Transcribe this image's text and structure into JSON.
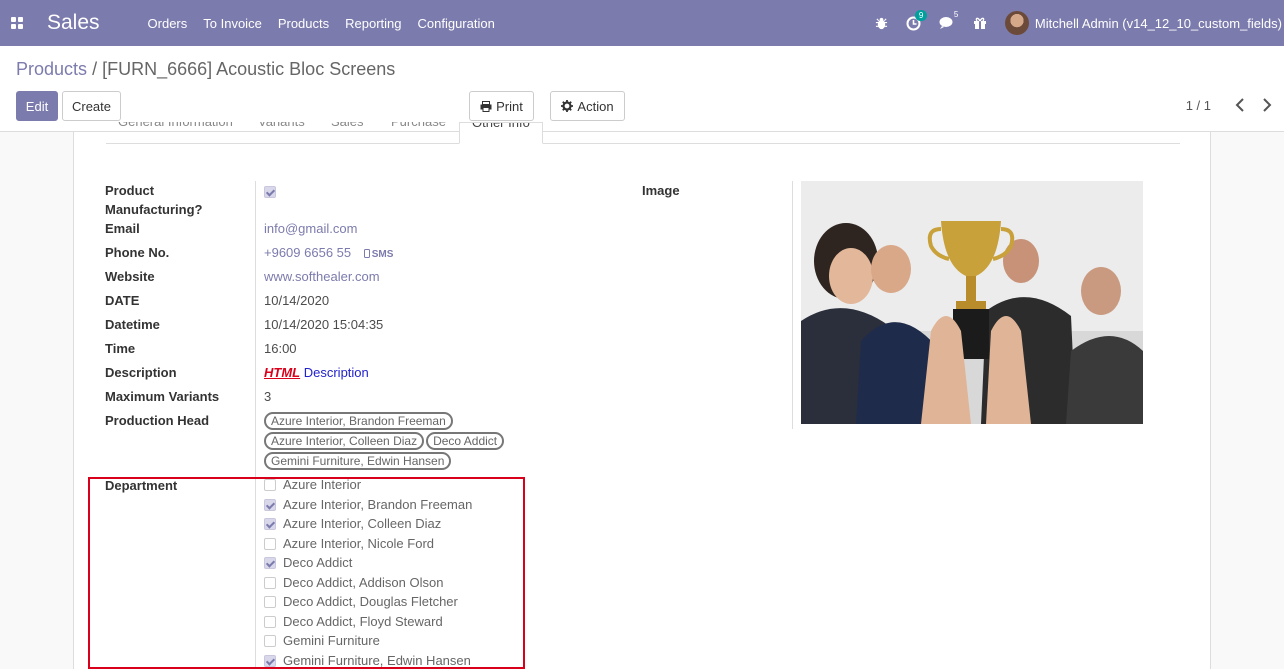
{
  "navbar": {
    "app_name": "Sales",
    "menu": [
      "Orders",
      "To Invoice",
      "Products",
      "Reporting",
      "Configuration"
    ],
    "activity_count": "9",
    "messages_count": "5",
    "user": "Mitchell Admin (v14_12_10_custom_fields)"
  },
  "breadcrumb": {
    "parent": "Products",
    "separator": "/",
    "current": "[FURN_6666] Acoustic Bloc Screens"
  },
  "buttons": {
    "edit": "Edit",
    "create": "Create",
    "print": "Print",
    "action": "Action"
  },
  "pager": {
    "value": "1 / 1"
  },
  "tabs": [
    "General Information",
    "Variants",
    "Sales",
    "Purchase",
    "Other Info"
  ],
  "form": {
    "product_manufacturing_label_1": "Product",
    "product_manufacturing_label_2": "Manufacturing?",
    "product_manufacturing_checked": true,
    "email_label": "Email",
    "email": "info@gmail.com",
    "phone_label": "Phone No.",
    "phone": "+9609 6656 55",
    "sms": "SMS",
    "website_label": "Website",
    "website": "www.softhealer.com",
    "date_label": "DATE",
    "date": "10/14/2020",
    "datetime_label": "Datetime",
    "datetime": "10/14/2020 15:04:35",
    "time_label": "Time",
    "time": "16:00",
    "description_label": "Description",
    "description_html": "HTML",
    "description_text": "Description",
    "max_variants_label": "Maximum Variants",
    "max_variants": "3",
    "production_head_label": "Production Head",
    "production_head_tags": [
      "Azure Interior, Brandon Freeman",
      "Azure Interior, Colleen Diaz",
      "Deco Addict",
      "Gemini Furniture, Edwin Hansen"
    ],
    "image_label": "Image",
    "department_label": "Department",
    "departments": [
      {
        "label": "Azure Interior",
        "checked": false
      },
      {
        "label": "Azure Interior, Brandon Freeman",
        "checked": true
      },
      {
        "label": "Azure Interior, Colleen Diaz",
        "checked": true
      },
      {
        "label": "Azure Interior, Nicole Ford",
        "checked": false
      },
      {
        "label": "Deco Addict",
        "checked": true
      },
      {
        "label": "Deco Addict, Addison Olson",
        "checked": false
      },
      {
        "label": "Deco Addict, Douglas Fletcher",
        "checked": false
      },
      {
        "label": "Deco Addict, Floyd Steward",
        "checked": false
      },
      {
        "label": "Gemini Furniture",
        "checked": false
      },
      {
        "label": "Gemini Furniture, Edwin Hansen",
        "checked": true
      }
    ]
  },
  "colors": {
    "brand": "#7c7bad",
    "highlight": "#d9001b",
    "badge": "#00a09d"
  }
}
